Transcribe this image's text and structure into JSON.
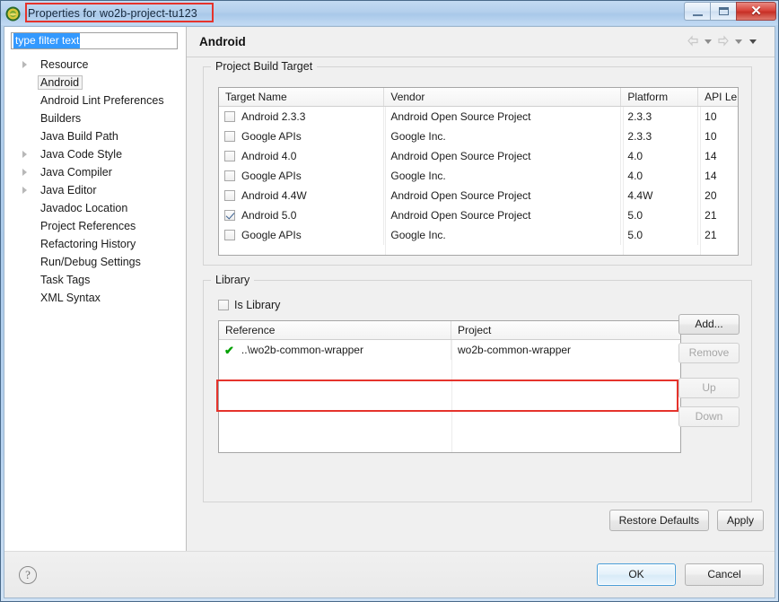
{
  "window": {
    "title": "Properties for wo2b-project-tu123",
    "app_icon": "eclipse-icon",
    "minimize_label": "Minimize",
    "maximize_label": "Maximize",
    "close_label": "✕"
  },
  "sidebar": {
    "filter": {
      "value": "type filter text",
      "placeholder": "type filter text"
    },
    "items": [
      {
        "label": "Resource",
        "expandable": true,
        "selected": false
      },
      {
        "label": "Android",
        "expandable": false,
        "selected": true
      },
      {
        "label": "Android Lint Preferences",
        "expandable": false,
        "selected": false
      },
      {
        "label": "Builders",
        "expandable": false,
        "selected": false
      },
      {
        "label": "Java Build Path",
        "expandable": false,
        "selected": false
      },
      {
        "label": "Java Code Style",
        "expandable": true,
        "selected": false
      },
      {
        "label": "Java Compiler",
        "expandable": true,
        "selected": false
      },
      {
        "label": "Java Editor",
        "expandable": true,
        "selected": false
      },
      {
        "label": "Javadoc Location",
        "expandable": false,
        "selected": false
      },
      {
        "label": "Project References",
        "expandable": false,
        "selected": false
      },
      {
        "label": "Refactoring History",
        "expandable": false,
        "selected": false
      },
      {
        "label": "Run/Debug Settings",
        "expandable": false,
        "selected": false
      },
      {
        "label": "Task Tags",
        "expandable": false,
        "selected": false
      },
      {
        "label": "XML Syntax",
        "expandable": false,
        "selected": false
      }
    ]
  },
  "main": {
    "title": "Android",
    "nav": {
      "back_icon": "back-arrow-icon",
      "back_menu_icon": "chevron-down-icon",
      "forward_icon": "forward-arrow-icon",
      "forward_menu_icon": "chevron-down-icon",
      "view_menu_icon": "chevron-down-icon"
    },
    "build_target": {
      "group_title": "Project Build Target",
      "columns": [
        "Target Name",
        "Vendor",
        "Platform",
        "API Le..."
      ],
      "rows": [
        {
          "checked": false,
          "name": "Android 2.3.3",
          "vendor": "Android Open Source Project",
          "platform": "2.3.3",
          "api": "10"
        },
        {
          "checked": false,
          "name": "Google APIs",
          "vendor": "Google Inc.",
          "platform": "2.3.3",
          "api": "10"
        },
        {
          "checked": false,
          "name": "Android 4.0",
          "vendor": "Android Open Source Project",
          "platform": "4.0",
          "api": "14"
        },
        {
          "checked": false,
          "name": "Google APIs",
          "vendor": "Google Inc.",
          "platform": "4.0",
          "api": "14"
        },
        {
          "checked": false,
          "name": "Android 4.4W",
          "vendor": "Android Open Source Project",
          "platform": "4.4W",
          "api": "20"
        },
        {
          "checked": true,
          "name": "Android 5.0",
          "vendor": "Android Open Source Project",
          "platform": "5.0",
          "api": "21"
        },
        {
          "checked": false,
          "name": "Google APIs",
          "vendor": "Google Inc.",
          "platform": "5.0",
          "api": "21"
        }
      ]
    },
    "library": {
      "group_title": "Library",
      "is_library_label": "Is Library",
      "is_library_checked": false,
      "columns": [
        "Reference",
        "Project"
      ],
      "rows": [
        {
          "status_icon": "green-check-icon",
          "reference": "..\\wo2b-common-wrapper",
          "project": "wo2b-common-wrapper"
        }
      ],
      "buttons": [
        {
          "label": "Add...",
          "enabled": true
        },
        {
          "label": "Remove",
          "enabled": false
        },
        {
          "label": "Up",
          "enabled": false
        },
        {
          "label": "Down",
          "enabled": false
        }
      ]
    },
    "bottom_buttons": [
      {
        "label": "Restore Defaults",
        "enabled": true
      },
      {
        "label": "Apply",
        "enabled": true
      }
    ]
  },
  "footer": {
    "help_icon": "question-mark-icon",
    "help_glyph": "?",
    "buttons": [
      {
        "label": "OK",
        "default": true
      },
      {
        "label": "Cancel",
        "default": false
      }
    ]
  },
  "annotations": {
    "accent_color": "#e5332c",
    "title_highlight": "Properties for wo2b-project-tu123",
    "library_row_highlight": "..\\wo2b-common-wrapper"
  }
}
